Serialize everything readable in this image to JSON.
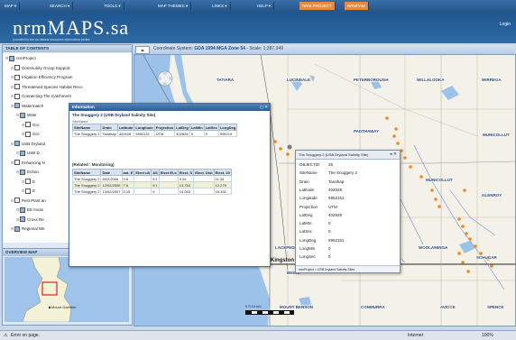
{
  "menu": [
    "MAP ▾",
    "SEARCH ▾",
    "TOOLS ▾",
    "MAP THEMES ▾",
    "LINKS ▾",
    "HELP ▾",
    "NRM PROJECT",
    "NRMPAM"
  ],
  "header": {
    "logo": "nrmMAPS.sa",
    "tagline": "provided by the sa natural resources information centre",
    "login": "Login"
  },
  "toc": {
    "title": "TABLE OF CONTENTS",
    "items": [
      "nrmProject",
      "Community Group Support",
      "Irrigation Efficiency Program",
      "Threatened Species Habitat Reco",
      "Connecting The Catchment",
      "Watermatch",
      "Wate",
      "Gro",
      "Gro",
      "USB Dryland",
      "USB D",
      "Enhancing N",
      "Enhan",
      "E",
      "E",
      "Pest Plant an",
      "EE Invas",
      "Cross Re",
      "Regional We"
    ]
  },
  "overview": {
    "title": "OVERVIEW MAP",
    "label": "Mount Gambier"
  },
  "mapbar": {
    "coord_label": "Coordinate System:",
    "coord_value": "GDA 1994 MGA Zone 54",
    "scale": "- Scale: 1:387,349",
    "zoom": "◂▸"
  },
  "places": [
    "TATIARA",
    "LUCINDALE",
    "PETERBOROUGH",
    "WILLALOOKA",
    "WIRREGA",
    "PADTHAWAY",
    "MUNICOLLUT",
    "GLENROY",
    "WOOLAMINGA",
    "SCHUGAR",
    "LACEPEDE",
    "Kingston",
    "BEEJE",
    "MOUNT BENSON",
    "CONMURRA",
    "AVICCE",
    "SPENCE"
  ],
  "info": {
    "title": "Information",
    "section1": "The Snuggery 2 (USB Dryland Salinity Site)",
    "section1_sub": "SiteName",
    "columns1": [
      "SiteName",
      "Drain",
      "Latitude",
      "Longitude",
      "Projection",
      "LatDeg",
      "LatMin",
      "LatSec",
      "LongDeg"
    ],
    "row1": [
      "The Snuggery 2",
      "Tanahap",
      "402628",
      "5952151",
      "UTM",
      "402628",
      "0",
      "0",
      "595215"
    ],
    "section2": "(Related : Monitoring)",
    "columns2": [
      "SiteName",
      "Date",
      "ant. E",
      "Elect uS",
      "AS",
      "Elect ELs",
      "Elect. S",
      "Elect. Dist",
      "Elect. 20"
    ],
    "rows2": [
      [
        "The Snuggery 2",
        "8/02/2006",
        "0.6",
        "",
        "9.1",
        "",
        "0.92",
        "",
        "11.34"
      ],
      [
        "The Snuggery 2",
        "12/02/2008",
        "7.6",
        "",
        "9.1",
        "",
        "13.764",
        "",
        "12.279"
      ],
      [
        "The Snuggery 2",
        "13/02/2007",
        "0.15",
        "",
        "9",
        "",
        "14.043",
        "",
        "15.331"
      ]
    ]
  },
  "popup": {
    "title": "The Snuggery 2 (USB Dryland Salinity Site)",
    "rows": [
      [
        "OBJECTID",
        "25"
      ],
      [
        "SiteName",
        "The Snuggery 2"
      ],
      [
        "Drain",
        "Tanahap"
      ],
      [
        "Latitude",
        "402628"
      ],
      [
        "Longitude",
        "5952151"
      ],
      [
        "Projection",
        "UTM"
      ],
      [
        "LatDeg",
        "402628"
      ],
      [
        "LatMin",
        "0"
      ],
      [
        "LatSec",
        "0"
      ],
      [
        "LongDeg",
        "5952151"
      ],
      [
        "LongMin",
        "0"
      ],
      [
        "LongSec",
        "0"
      ]
    ],
    "footer": "nrmProject > USB Dryland Salinity Sites"
  },
  "scale": "0      5      10 km",
  "status": {
    "left": "Error on page.",
    "internet": "Internet",
    "zoom": "100%"
  },
  "colors": {
    "header_blue": "#245487",
    "site_orange": "#f08a1c",
    "water_blue": "#9cc2ea"
  }
}
